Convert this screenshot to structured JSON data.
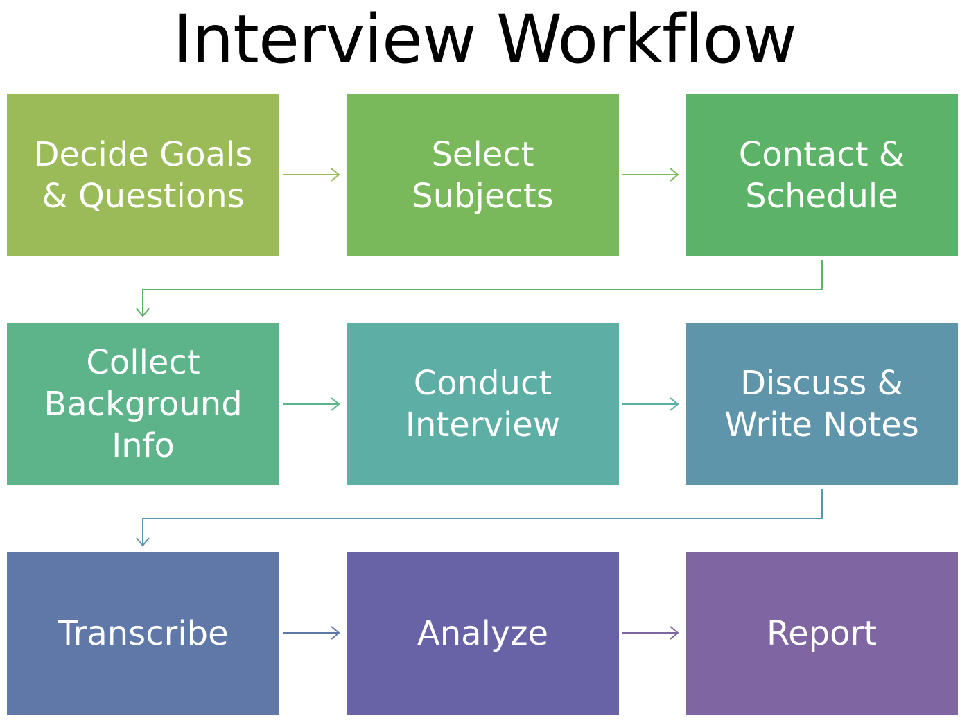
{
  "title": "Interview Workflow",
  "steps": [
    {
      "label": "Decide Goals\n& Questions",
      "color": "#9bbb59"
    },
    {
      "label": "Select Subjects",
      "color": "#7ab85c"
    },
    {
      "label": "Contact &\nSchedule",
      "color": "#5cb266"
    },
    {
      "label": "Collect\nBackground\nInfo",
      "color": "#5db38a"
    },
    {
      "label": "Conduct\nInterview",
      "color": "#5daea5"
    },
    {
      "label": "Discuss &\nWrite Notes",
      "color": "#5f95aa"
    },
    {
      "label": "Transcribe",
      "color": "#6078a8"
    },
    {
      "label": "Analyze",
      "color": "#6763a6"
    },
    {
      "label": "Report",
      "color": "#7f66a2"
    }
  ],
  "connectors": [
    {
      "from": 0,
      "to": 1,
      "color": "#9bbb59"
    },
    {
      "from": 1,
      "to": 2,
      "color": "#7ab85c"
    },
    {
      "from": 2,
      "to": 3,
      "color": "#5cb266"
    },
    {
      "from": 3,
      "to": 4,
      "color": "#5db38a"
    },
    {
      "from": 4,
      "to": 5,
      "color": "#5daea5"
    },
    {
      "from": 5,
      "to": 6,
      "color": "#5f95aa"
    },
    {
      "from": 6,
      "to": 7,
      "color": "#6078a8"
    },
    {
      "from": 7,
      "to": 8,
      "color": "#7f66a2"
    }
  ]
}
